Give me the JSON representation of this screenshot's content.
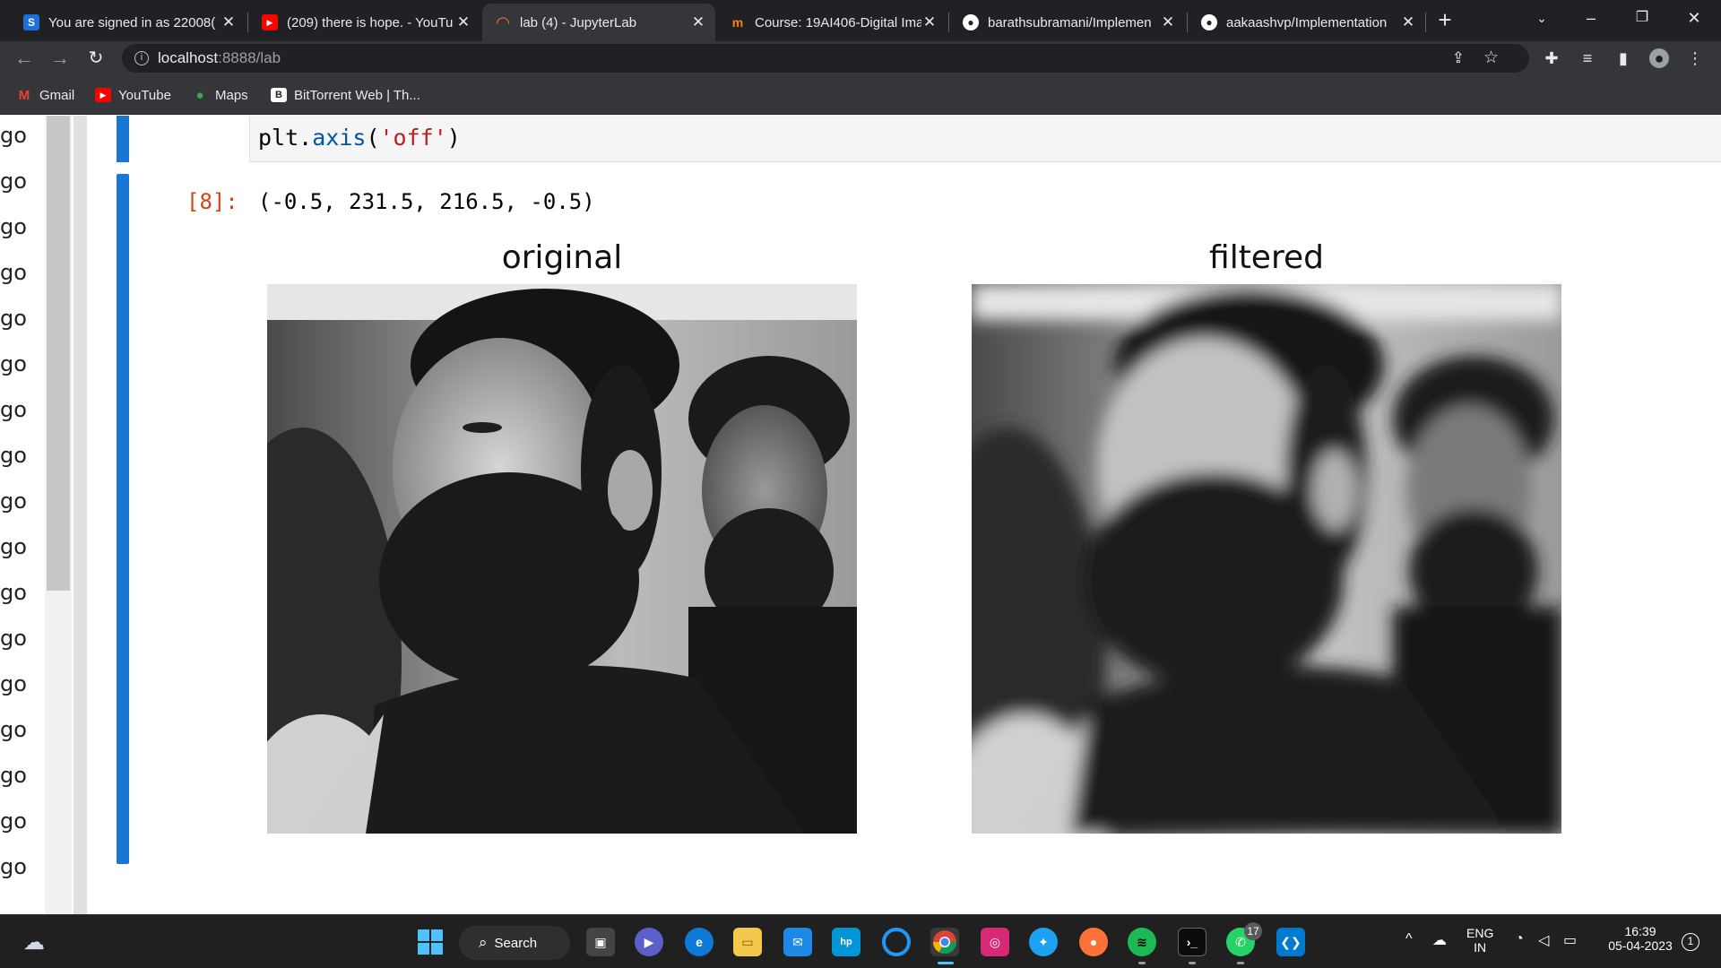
{
  "browser": {
    "tabs": [
      {
        "title": "You are signed in as 22008(",
        "icon": "skillrack-icon",
        "active": false
      },
      {
        "title": "(209) there is hope. - YouTu",
        "icon": "youtube-icon",
        "active": false
      },
      {
        "title": "lab (4) - JupyterLab",
        "icon": "jupyter-icon",
        "active": true
      },
      {
        "title": "Course: 19AI406-Digital Ima",
        "icon": "moodle-icon",
        "active": false
      },
      {
        "title": "barathsubramani/Implemen",
        "icon": "github-icon",
        "active": false
      },
      {
        "title": "aakaashvp/Implementation",
        "icon": "github-icon",
        "active": false
      }
    ],
    "new_tab_label": "+",
    "url_host": "localhost",
    "url_path": ":8888/lab",
    "bookmarks": [
      {
        "label": "Gmail",
        "icon": "gmail-icon"
      },
      {
        "label": "YouTube",
        "icon": "youtube-icon"
      },
      {
        "label": "Maps",
        "icon": "maps-icon"
      },
      {
        "label": "BitTorrent Web | Th...",
        "icon": "bittorrent-icon"
      }
    ],
    "colors": {
      "frame": "#202124",
      "toolbar": "#35363a",
      "text": "#e8eaed"
    }
  },
  "jupyter": {
    "left_panel_items": [
      "go",
      "go",
      "go",
      "go",
      "go",
      "go",
      "go",
      "go",
      "go",
      "go",
      "go",
      "go",
      "go",
      "go",
      "go",
      "go",
      "go"
    ],
    "code": {
      "prefix": "plt.",
      "func": "axis",
      "open": "(",
      "arg": "'off'",
      "close": ")"
    },
    "output_prompt": "[8]:",
    "output_text": "(-0.5, 231.5, 216.5, -0.5)",
    "figures": [
      {
        "title": "original",
        "kind": "photo-sharp"
      },
      {
        "title": "filtered",
        "kind": "photo-blurred"
      }
    ],
    "accent_color": "#1976d2"
  },
  "taskbar": {
    "search_label": "Search",
    "apps": [
      "start-icon",
      "search-icon",
      "task-view-icon",
      "teams-icon",
      "edge-icon",
      "file-explorer-icon",
      "mail-icon",
      "myhp-icon",
      "cortana-icon",
      "chrome-icon",
      "instagram-icon",
      "twitter-icon",
      "firefox-icon",
      "spotify-icon",
      "terminal-icon",
      "whatsapp-icon",
      "vscode-icon"
    ],
    "whatsapp_badge": "17",
    "language": "ENG",
    "region": "IN",
    "time": "16:39",
    "date": "05-04-2023",
    "notification_count": "1"
  }
}
